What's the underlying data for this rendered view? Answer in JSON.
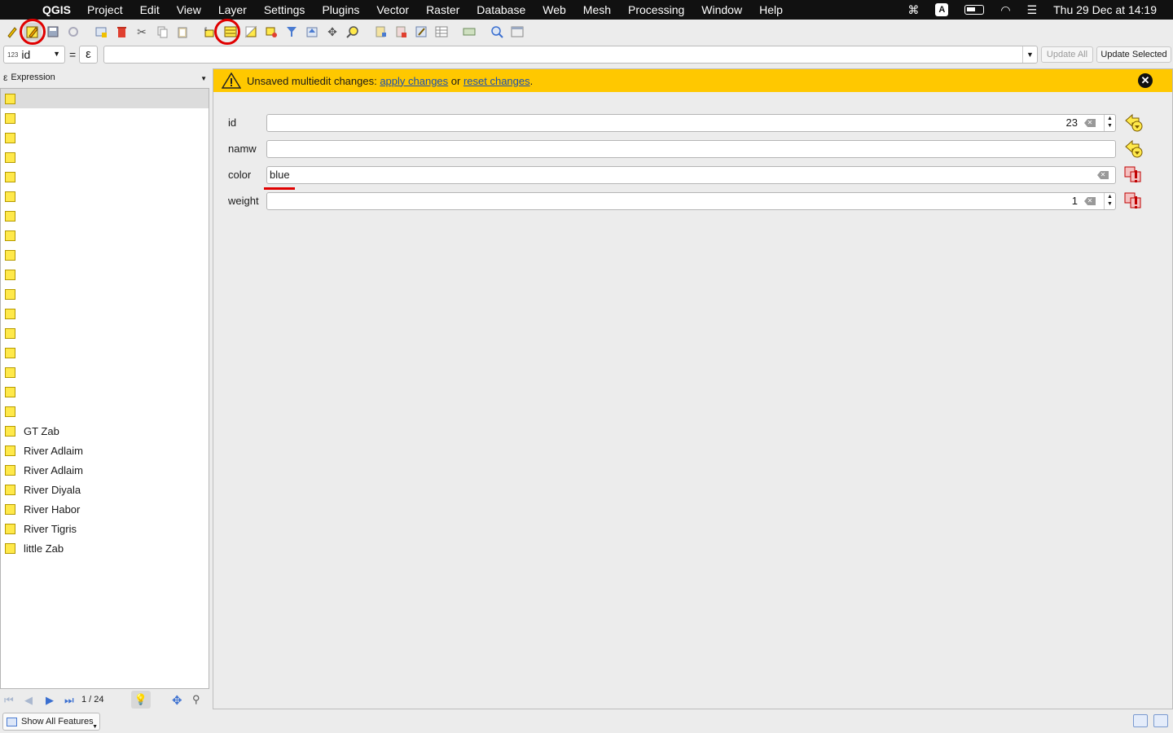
{
  "menubar": {
    "app_name": "QGIS",
    "items": [
      "Project",
      "Edit",
      "View",
      "Layer",
      "Settings",
      "Plugins",
      "Vector",
      "Raster",
      "Database",
      "Web",
      "Mesh",
      "Processing",
      "Window",
      "Help"
    ],
    "input_indicator": "A",
    "datetime": "Thu 29 Dec at 14:19"
  },
  "expression_bar": {
    "field_type_prefix": "123",
    "field_name": "id",
    "equals": "=",
    "epsilon": "ε",
    "expression_value": "",
    "update_all_label": "Update All",
    "update_selected_label": "Update Selected"
  },
  "left_panel": {
    "header_label": "Expression",
    "features": [
      {
        "label": "",
        "selected": true
      },
      {
        "label": ""
      },
      {
        "label": ""
      },
      {
        "label": ""
      },
      {
        "label": ""
      },
      {
        "label": ""
      },
      {
        "label": ""
      },
      {
        "label": ""
      },
      {
        "label": ""
      },
      {
        "label": ""
      },
      {
        "label": ""
      },
      {
        "label": ""
      },
      {
        "label": ""
      },
      {
        "label": ""
      },
      {
        "label": ""
      },
      {
        "label": ""
      },
      {
        "label": ""
      },
      {
        "label": "GT Zab"
      },
      {
        "label": "River Adlaim"
      },
      {
        "label": "River Adlaim"
      },
      {
        "label": "River Diyala"
      },
      {
        "label": "River Habor"
      },
      {
        "label": "River Tigris"
      },
      {
        "label": "little Zab"
      }
    ],
    "nav_count": "1 / 24",
    "show_all_label": "Show All Features"
  },
  "banner": {
    "prefix": "Unsaved multiedit changes: ",
    "apply_link": "apply changes",
    "middle": " or ",
    "reset_link": "reset changes",
    "suffix": ".",
    "color": "#ffc800"
  },
  "form": {
    "fields": [
      {
        "label": "id",
        "value": "23"
      },
      {
        "label": "namw",
        "value": ""
      },
      {
        "label": "color",
        "value": "blue"
      },
      {
        "label": "weight",
        "value": "1"
      }
    ]
  },
  "colors": {
    "highlight_red": "#e00000",
    "feature_symbol": "#ffe94a",
    "banner": "#ffc800"
  }
}
